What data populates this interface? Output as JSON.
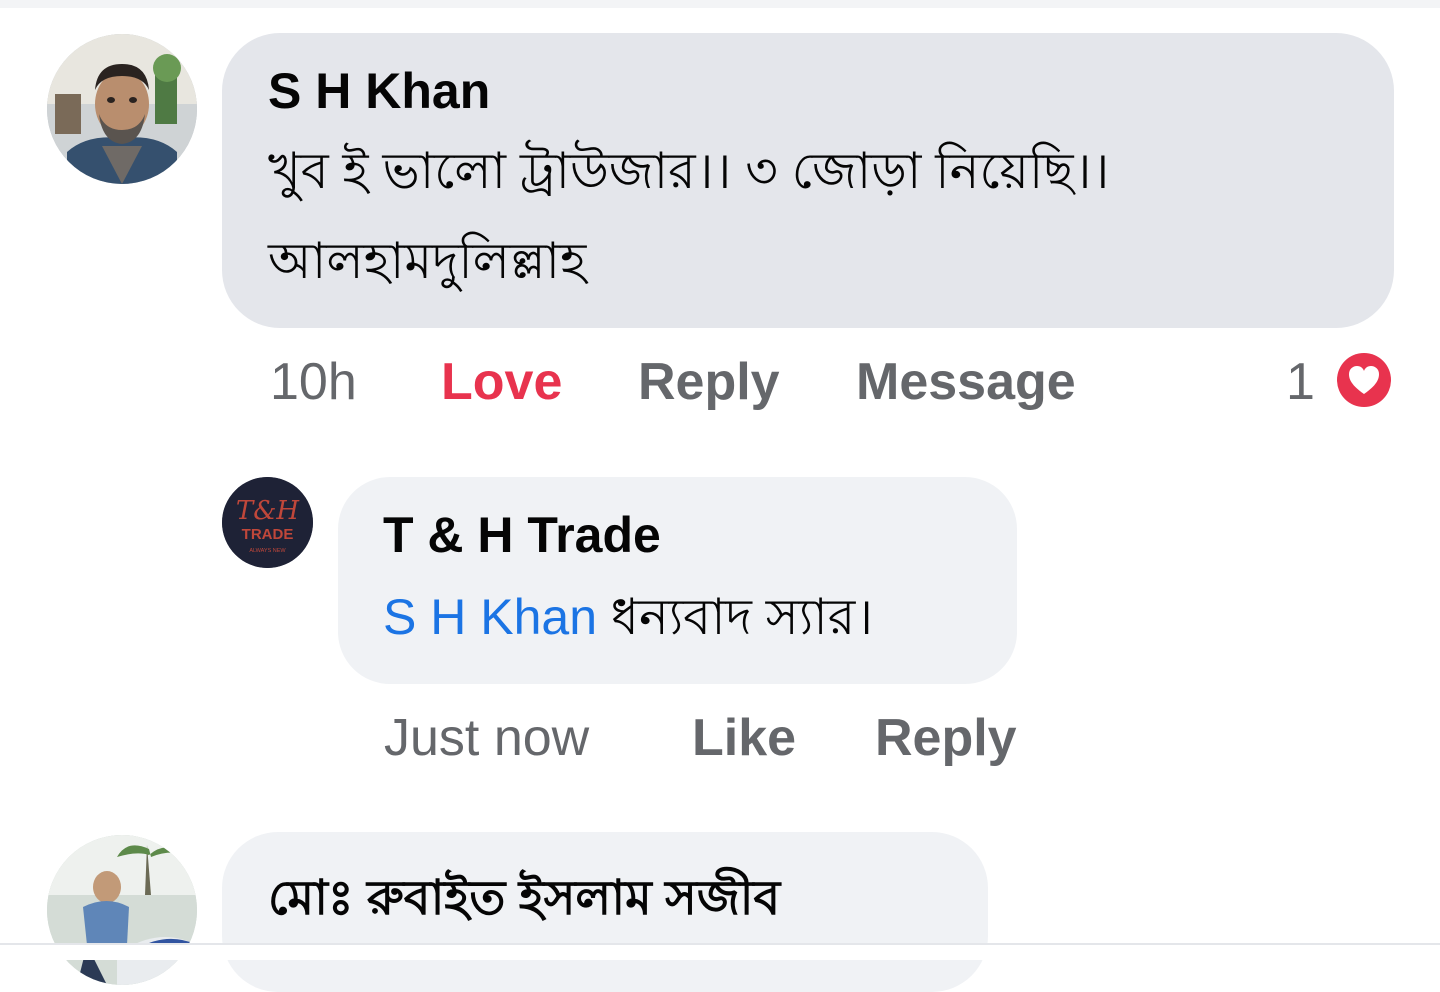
{
  "comments": [
    {
      "author": "S H Khan",
      "text_line1": "খুব ই ভালো ট্রাউজার।। ৩ জোড়া নিয়েছি।।",
      "text_line2": "আলহামদুলিল্লাহ",
      "actions": {
        "time": "10h",
        "reaction_label": "Love",
        "reply": "Reply",
        "message": "Message"
      },
      "reaction_count": "1",
      "reaction_icon": "heart-icon",
      "reaction_color": "#e8334e"
    },
    {
      "author": "T & H Trade",
      "mention": "S H Khan",
      "text": "ধন্যবাদ স্যার।",
      "avatar_logo": {
        "line1": "T&H",
        "line2": "TRADE",
        "line3": "ALWAYS NEW"
      },
      "actions": {
        "time": "Just now",
        "like": "Like",
        "reply": "Reply"
      }
    },
    {
      "author": "মোঃ রুবাইত ইসলাম সজীব"
    }
  ],
  "colors": {
    "accent_link": "#1b74e4",
    "love_red": "#e8334e",
    "bubble_primary": "#e4e6eb",
    "bubble_secondary": "#f0f2f5",
    "meta_text": "#65676b"
  }
}
